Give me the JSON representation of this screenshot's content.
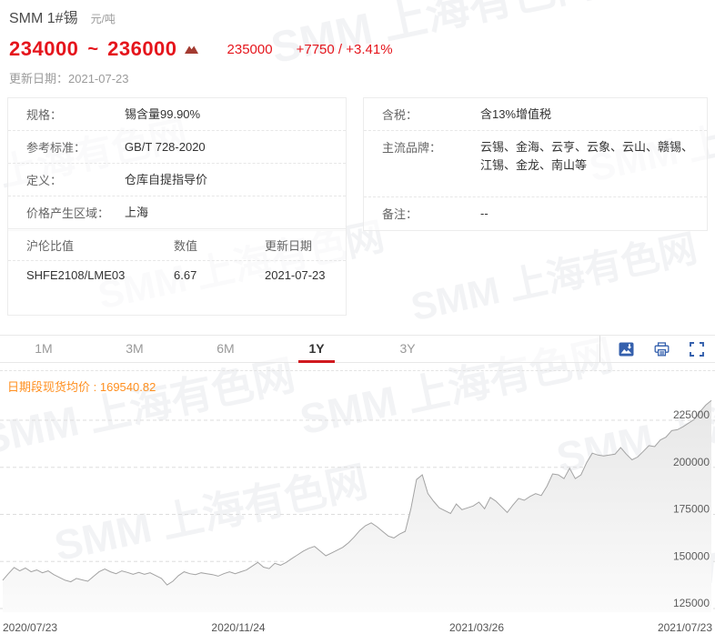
{
  "header": {
    "title": "SMM 1#锡",
    "unit": "元/吨",
    "price_low": "234000",
    "tilde": "~",
    "price_high": "236000",
    "price_avg": "235000",
    "change_abs": "+7750",
    "change_sep": "/",
    "change_pct": "+3.41%",
    "update_date": "更新日期：2021-07-23",
    "price_color": "#e5151c",
    "arrow_color": "#a33b31"
  },
  "info_left": {
    "rows": [
      {
        "label": "规格：",
        "value": "锡含量99.90%"
      },
      {
        "label": "参考标准：",
        "value": "GB/T 728-2020"
      },
      {
        "label": "定义：",
        "value": "仓库自提指导价"
      },
      {
        "label": "价格产生区域：",
        "value": "上海"
      }
    ]
  },
  "info_right": {
    "rows": [
      {
        "label": "含税：",
        "value": "含13%增值税"
      },
      {
        "label": "主流品牌：",
        "value": "云锡、金海、云亨、云象、云山、赣锡、江锡、金龙、南山等"
      },
      {
        "label": "备注：",
        "value": "--"
      }
    ]
  },
  "ratio_table": {
    "headers": [
      "沪伦比值",
      "数值",
      "更新日期"
    ],
    "rows": [
      [
        "SHFE2108/LME03",
        "6.67",
        "2021-07-23"
      ]
    ]
  },
  "toolbar": {
    "tabs": [
      {
        "label": "1M",
        "active": false
      },
      {
        "label": "3M",
        "active": false
      },
      {
        "label": "6M",
        "active": false
      },
      {
        "label": "1Y",
        "active": true
      },
      {
        "label": "3Y",
        "active": false
      }
    ],
    "active_color": "#d0191f",
    "icons": [
      "save-image-icon",
      "print-icon",
      "fullscreen-icon"
    ],
    "icon_color": "#3560ad"
  },
  "avg_line": {
    "label": "日期段现货均价 :",
    "value": "169540.82",
    "color": "#ff8f1f"
  },
  "watermark": {
    "text": "SMM 上海有色网"
  },
  "chart_data": {
    "type": "area",
    "title": "",
    "x_labels": [
      "2020/07/23",
      "2020/11/24",
      "2021/03/26",
      "2021/07/23"
    ],
    "y_ticks": [
      225000,
      200000,
      175000,
      150000,
      125000
    ],
    "ylim": [
      125000,
      240000
    ],
    "grid": "dashed-horizontal",
    "legend": "none",
    "line_color": "#a3a3a3",
    "values": [
      140000,
      143500,
      146800,
      145000,
      146500,
      144500,
      145500,
      144000,
      145000,
      143000,
      141500,
      140000,
      139200,
      141000,
      140200,
      139500,
      142000,
      144500,
      146000,
      144500,
      143500,
      145000,
      144200,
      143200,
      144200,
      143200,
      144000,
      142500,
      141000,
      137500,
      139500,
      142500,
      144500,
      143500,
      143000,
      144000,
      143500,
      143000,
      142200,
      143500,
      144500,
      143500,
      144500,
      145500,
      147500,
      149500,
      147000,
      146200,
      149000,
      148000,
      149500,
      151500,
      153500,
      155500,
      157000,
      158000,
      155500,
      153000,
      154500,
      156000,
      157500,
      160000,
      163000,
      166500,
      169000,
      170500,
      168500,
      166000,
      163500,
      162500,
      164500,
      166000,
      178000,
      193500,
      196000,
      186000,
      182000,
      178500,
      177000,
      175500,
      180500,
      177500,
      178500,
      179500,
      181500,
      178000,
      184000,
      182000,
      179000,
      176000,
      180000,
      183500,
      182500,
      184500,
      186000,
      185000,
      190000,
      196500,
      196000,
      194000,
      199500,
      194000,
      196000,
      202500,
      207500,
      206500,
      206000,
      206500,
      207000,
      210500,
      207000,
      204000,
      205500,
      208500,
      211500,
      211000,
      214500,
      216000,
      219500,
      220000,
      221500,
      223500,
      225500,
      229500,
      233000,
      235500
    ]
  }
}
